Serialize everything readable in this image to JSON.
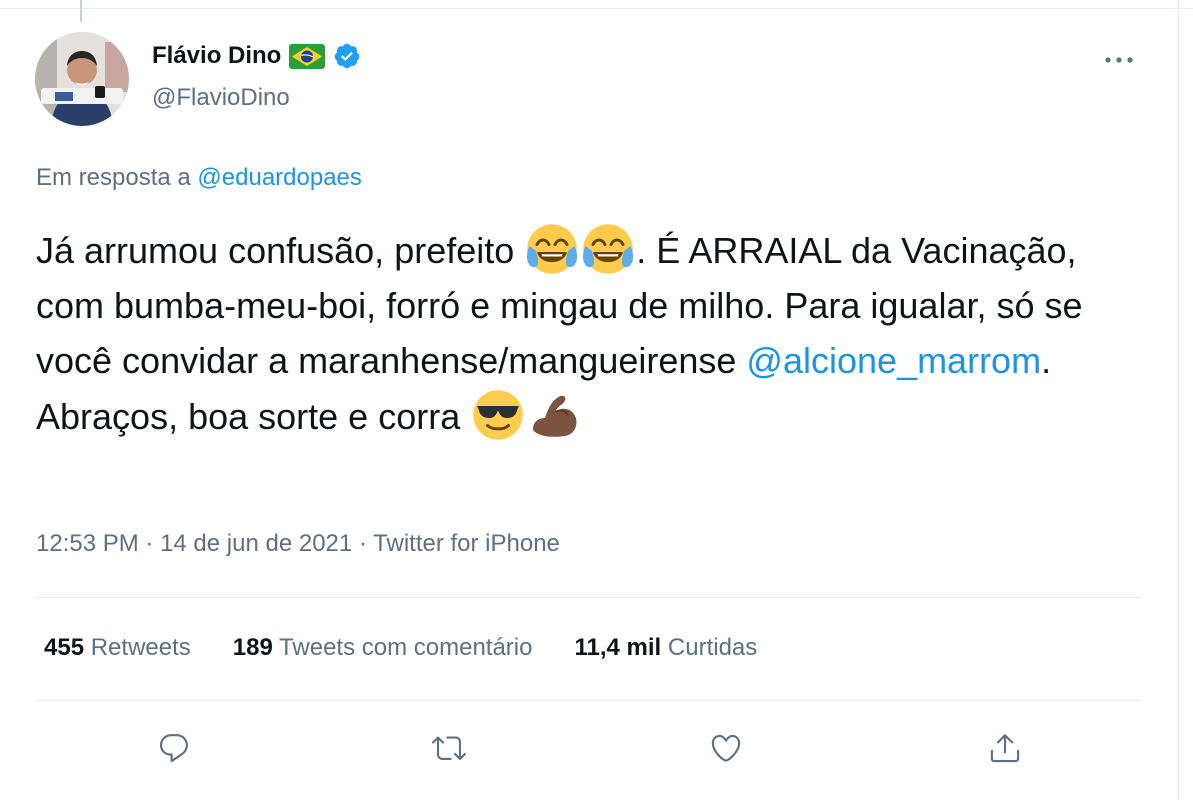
{
  "author": {
    "display_name": "Flávio Dino",
    "handle": "@FlavioDino",
    "flag_icon": "brazil-flag-icon",
    "verified_icon": "verified-badge-icon"
  },
  "reply_context": {
    "prefix": "Em resposta a ",
    "mention": "@eduardopaes"
  },
  "tweet": {
    "segments": {
      "s1": "Já arrumou confusão, prefeito ",
      "s2": ". É ARRAIAL da Vacinação, com bumba-meu-boi, forró e mingau de milho. Para igualar, só se você convidar a maranhense/mangueirense ",
      "mention": "@alcione_marrom",
      "s3": ". Abraços, boa sorte e corra "
    },
    "emojis": [
      "face-with-tears-of-joy",
      "face-with-tears-of-joy",
      "smiling-face-with-sunglasses",
      "flexed-biceps-medium-dark-skin"
    ]
  },
  "meta": {
    "time": "12:53 PM",
    "sep": " · ",
    "date": "14 de jun de 2021",
    "source": "Twitter for iPhone"
  },
  "stats": {
    "retweets": {
      "count": "455",
      "label": "Retweets"
    },
    "quotes": {
      "count": "189",
      "label": "Tweets com comentário"
    },
    "likes": {
      "count": "11,4 mil",
      "label": "Curtidas"
    }
  },
  "colors": {
    "link": "#1b95e0",
    "secondary_text": "#5b7083",
    "verified": "#1da1f2",
    "divider": "#e6ecf0"
  },
  "icons": {
    "more": "more-options-icon",
    "reply": "reply-icon",
    "retweet": "retweet-icon",
    "like": "like-icon",
    "share": "share-icon"
  }
}
